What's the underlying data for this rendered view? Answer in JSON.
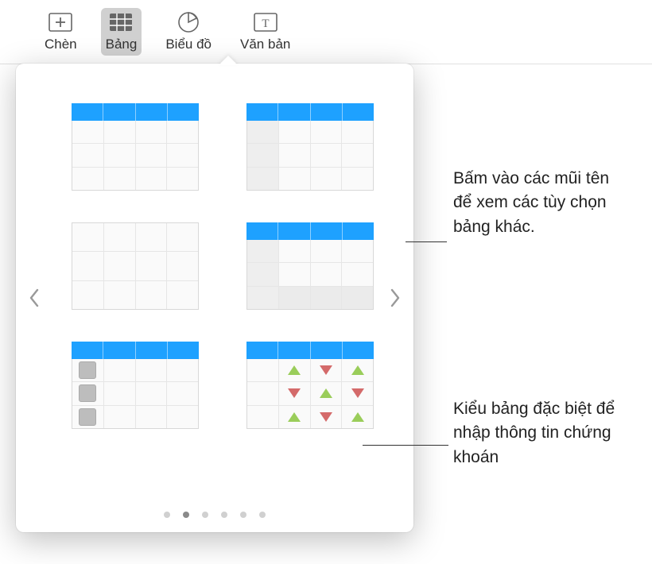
{
  "toolbar": {
    "items": [
      {
        "label": "Chèn",
        "icon": "insert-icon"
      },
      {
        "label": "Bảng",
        "icon": "table-icon"
      },
      {
        "label": "Biểu đồ",
        "icon": "chart-icon"
      },
      {
        "label": "Văn bản",
        "icon": "text-icon"
      }
    ]
  },
  "callouts": {
    "arrow": "Bấm vào các mũi tên để xem các tùy chọn bảng khác.",
    "stock": "Kiểu bảng đặc biệt để nhập thông tin chứng khoán"
  },
  "pager": {
    "total": 6,
    "active_index": 1
  },
  "table_styles": [
    {
      "name": "table-style-blue-header"
    },
    {
      "name": "table-style-blue-header-rowhead"
    },
    {
      "name": "table-style-plain"
    },
    {
      "name": "table-style-header-footer"
    },
    {
      "name": "table-style-checkbox"
    },
    {
      "name": "table-style-stock"
    }
  ],
  "colors": {
    "accent": "#1ea1ff",
    "up_triangle": "#9acd5a",
    "down_triangle": "#d46a6a"
  }
}
